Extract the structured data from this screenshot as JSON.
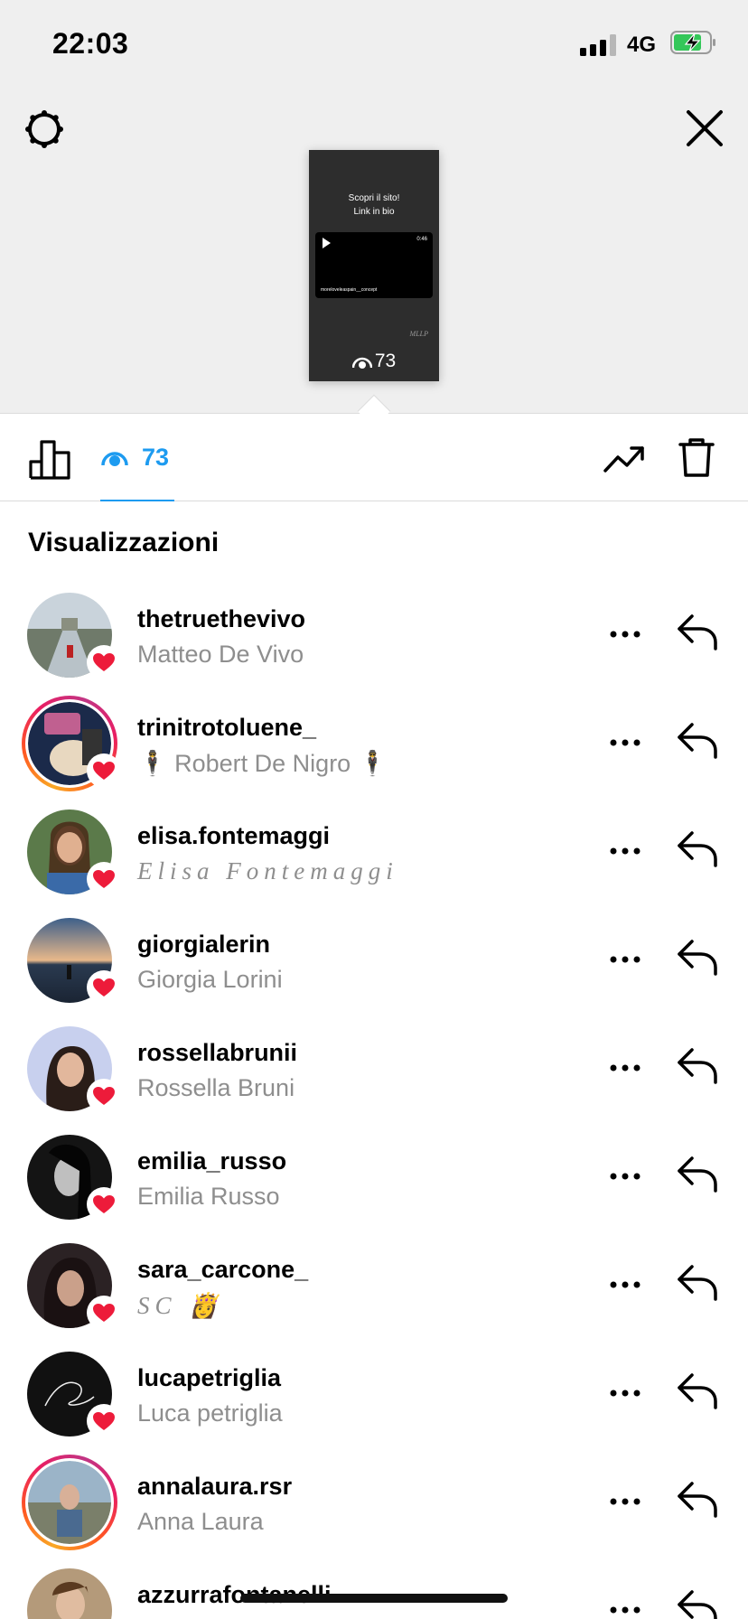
{
  "status": {
    "time": "22:03",
    "network": "4G"
  },
  "story_preview": {
    "text_line1": "Scopri il sito!",
    "text_line2": "Link in bio",
    "video_duration": "0:46",
    "video_caption": "moreloveleaspain__concept",
    "signature": "MLLP",
    "views": "73"
  },
  "tabs": {
    "viewers_count": "73"
  },
  "section_title": "Visualizzazioni",
  "viewers": [
    {
      "username": "thetruethevivo",
      "full_name": "Matteo De Vivo",
      "ring": false,
      "liked": true
    },
    {
      "username": "trinitrotoluene_",
      "full_name": "🕴 Robert De Nigro 🕴",
      "ring": true,
      "liked": true
    },
    {
      "username": "elisa.fontemaggi",
      "full_name": "Elisa Fontemaggi",
      "ring": false,
      "liked": true,
      "script": true
    },
    {
      "username": "giorgialerin",
      "full_name": "Giorgia Lorini",
      "ring": false,
      "liked": true
    },
    {
      "username": "rossellabrunii",
      "full_name": "Rossella Bruni",
      "ring": false,
      "liked": true
    },
    {
      "username": "emilia_russo",
      "full_name": "Emilia Russo",
      "ring": false,
      "liked": true
    },
    {
      "username": "sara_carcone_",
      "full_name": "SC 👸",
      "ring": false,
      "liked": true,
      "script": true
    },
    {
      "username": "lucapetriglia",
      "full_name": "Luca petriglia",
      "ring": false,
      "liked": true
    },
    {
      "username": "annalaura.rsr",
      "full_name": "Anna Laura",
      "ring": true,
      "liked": false
    },
    {
      "username": "azzurrafontanelli",
      "full_name": "",
      "ring": false,
      "liked": false
    }
  ],
  "colors": {
    "accent": "#1d9bf0",
    "heart": "#ed1b3a",
    "secondary_text": "#8e8e8e"
  }
}
